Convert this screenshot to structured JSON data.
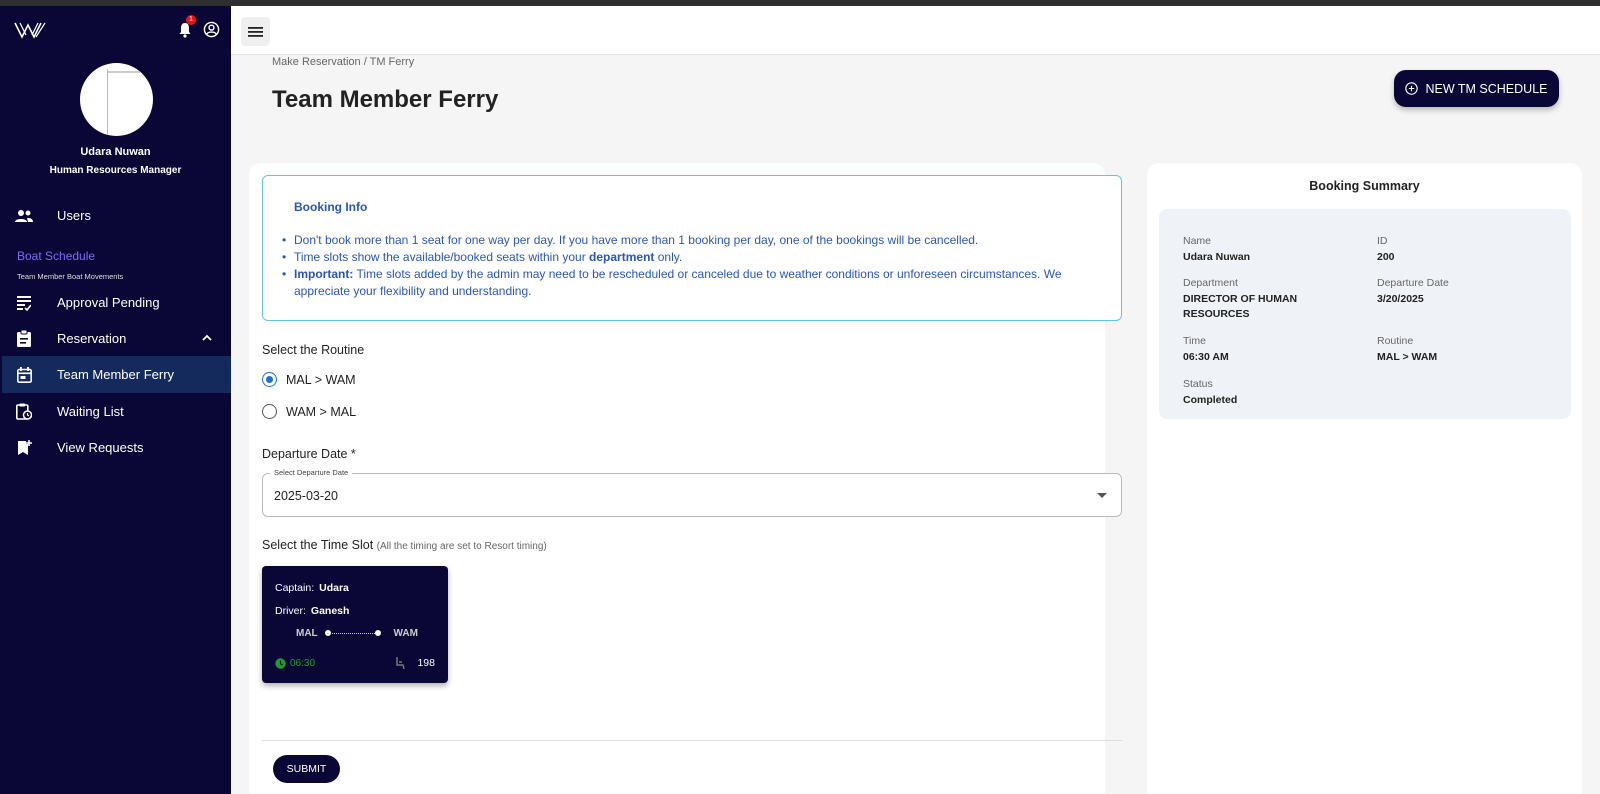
{
  "sidebar": {
    "user_name": "Udara Nuwan",
    "user_role": "Human Resources Manager",
    "notification_count": "1",
    "items": [
      {
        "label": "Users",
        "icon": "users-icon"
      },
      {
        "label": "Approval Pending",
        "icon": "checklist-icon"
      },
      {
        "label": "Reservation",
        "icon": "clipboard-icon"
      },
      {
        "label": "Team Member Ferry",
        "icon": "calendar-icon"
      },
      {
        "label": "Waiting List",
        "icon": "clipboard-clock-icon"
      },
      {
        "label": "View Requests",
        "icon": "bookmark-add-icon"
      }
    ],
    "section_title": "Boat Schedule",
    "section_subtitle": "Team Member Boat Movements"
  },
  "header": {
    "breadcrumb": "Make Reservation / TM Ferry",
    "title": "Team Member Ferry",
    "new_schedule_label": "NEW TM SCHEDULE"
  },
  "booking_info": {
    "title": "Booking Info",
    "line1": "Don't book more than 1 seat for one way per day. If you have more than 1 booking per day, one of the bookings will be cancelled.",
    "line2_before": "Time slots show the available/booked seats within your ",
    "line2_bold": "department",
    "line2_after": " only.",
    "line3_bold": "Important:",
    "line3_rest": " Time slots added by the admin may need to be rescheduled or canceled due to weather conditions or unforeseen circumstances. We appreciate your flexibility and understanding."
  },
  "form": {
    "routine_label": "Select the Routine",
    "routines": [
      "MAL > WAM",
      "WAM > MAL"
    ],
    "selected_routine": "MAL > WAM",
    "departure_label": "Departure Date *",
    "departure_legend": "Select Departure Date",
    "departure_value": "2025-03-20",
    "timeslot_label": "Select the Time Slot",
    "timeslot_hint": "(All the timing are set to Resort timing)",
    "submit_label": "SUBMIT"
  },
  "slot": {
    "captain_key": "Captain:",
    "captain": "Udara",
    "driver_key": "Driver:",
    "driver": "Ganesh",
    "from": "MAL",
    "to": "WAM",
    "time": "06:30",
    "seats": "198"
  },
  "summary": {
    "title": "Booking Summary",
    "name_key": "Name",
    "name": "Udara Nuwan",
    "id_key": "ID",
    "id": "200",
    "department_key": "Department",
    "department": "DIRECTOR OF HUMAN RESOURCES",
    "date_key": "Departure Date",
    "date": "3/20/2025",
    "time_key": "Time",
    "time": "06:30 AM",
    "routine_key": "Routine",
    "routine": "MAL > WAM",
    "status_key": "Status",
    "status": "Completed"
  },
  "colors": {
    "sidebar_bg": "#0a0737",
    "accent": "#1f6fd1",
    "info_text": "#2b56b8",
    "active_nav": "#142a5c",
    "time_green": "#1f9d2c"
  }
}
